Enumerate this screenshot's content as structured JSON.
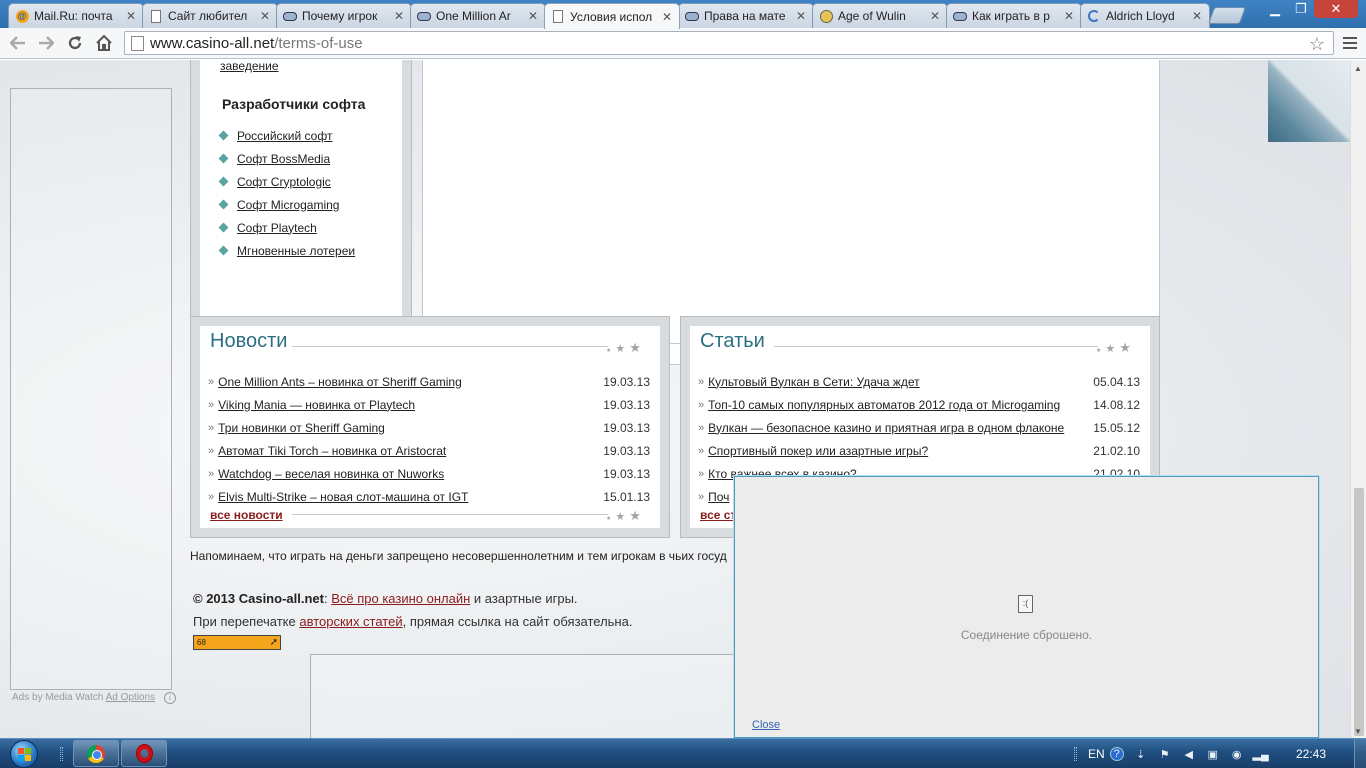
{
  "browser": {
    "tabs": [
      {
        "title": "Mail.Ru: почта",
        "icon": "mailru-icon"
      },
      {
        "title": "Сайт любител",
        "icon": "page-icon"
      },
      {
        "title": "Почему игрок",
        "icon": "casino-icon"
      },
      {
        "title": "One Million Ar",
        "icon": "casino-icon"
      },
      {
        "title": "Условия испол",
        "icon": "page-icon",
        "active": true
      },
      {
        "title": "Права на мате",
        "icon": "casino-icon"
      },
      {
        "title": "Age of Wulin",
        "icon": "game-icon"
      },
      {
        "title": "Как играть в р",
        "icon": "casino-icon"
      },
      {
        "title": "Aldrich Lloyd",
        "icon": "loading-icon"
      }
    ],
    "close_glyph": "✕",
    "url_host": "www.casino-all.net",
    "url_path": "/terms-of-use"
  },
  "page": {
    "side_prev_link": "заведение",
    "side_heading": "Разработчики софта",
    "dev_links": [
      "Российский софт",
      "Софт BossMedia",
      "Софт Cryptologic",
      "Софт Microgaming",
      "Софт Playtech",
      "Мгновенные лотереи"
    ],
    "news": {
      "title": "Новости",
      "items": [
        {
          "text": "One Million Ants – новинка от Sheriff Gaming",
          "date": "19.03.13"
        },
        {
          "text": "Viking Mania — новинка от Playtech",
          "date": "19.03.13"
        },
        {
          "text": "Три новинки от Sheriff Gaming",
          "date": "19.03.13"
        },
        {
          "text": "Автомат Tiki Torch – новинка от Aristocrat",
          "date": "19.03.13"
        },
        {
          "text": "Watchdog – веселая новинка от Nuworks",
          "date": "19.03.13"
        },
        {
          "text": "Elvis Multi-Strike – новая слот-машина от IGT",
          "date": "15.01.13"
        }
      ],
      "all_link": "все новости"
    },
    "articles": {
      "title": "Статьи",
      "items": [
        {
          "text": "Культовый Вулкан в Сети: Удача ждет",
          "date": "05.04.13"
        },
        {
          "text": "Топ-10 самых популярных автоматов 2012 года от Microgaming",
          "date": "14.08.12"
        },
        {
          "text": "Вулкан — безопасное казино и приятная игра в одном флаконе",
          "date": "15.05.12"
        },
        {
          "text": "Спортивный покер или азартные игры?",
          "date": "21.02.10"
        },
        {
          "text": "Кто важнее всех в казино?",
          "date": "21.02.10"
        },
        {
          "text": "Поч",
          "date": ""
        }
      ],
      "all_link": "все ст"
    },
    "warning": "Напоминаем, что играть на деньги запрещено несовершеннолетним и тем игрокам в чьих госуд",
    "copyright_prefix": "© 2013 Casino-all.net",
    "copyright_link": "Всё про казино онлайн",
    "copyright_suffix": "и азартные игры.",
    "reprint_prefix": "При перепечатке",
    "reprint_link": "авторских статей",
    "reprint_suffix": ", прямая ссылка на сайт обязательна.",
    "counter_text": "68",
    "ad_credit": "Ads by Media Watch",
    "ad_options": "Ad Options"
  },
  "popup": {
    "message": "Соединение сброшено.",
    "close_label": "Close"
  },
  "taskbar": {
    "language": "EN",
    "time": "22:43"
  }
}
